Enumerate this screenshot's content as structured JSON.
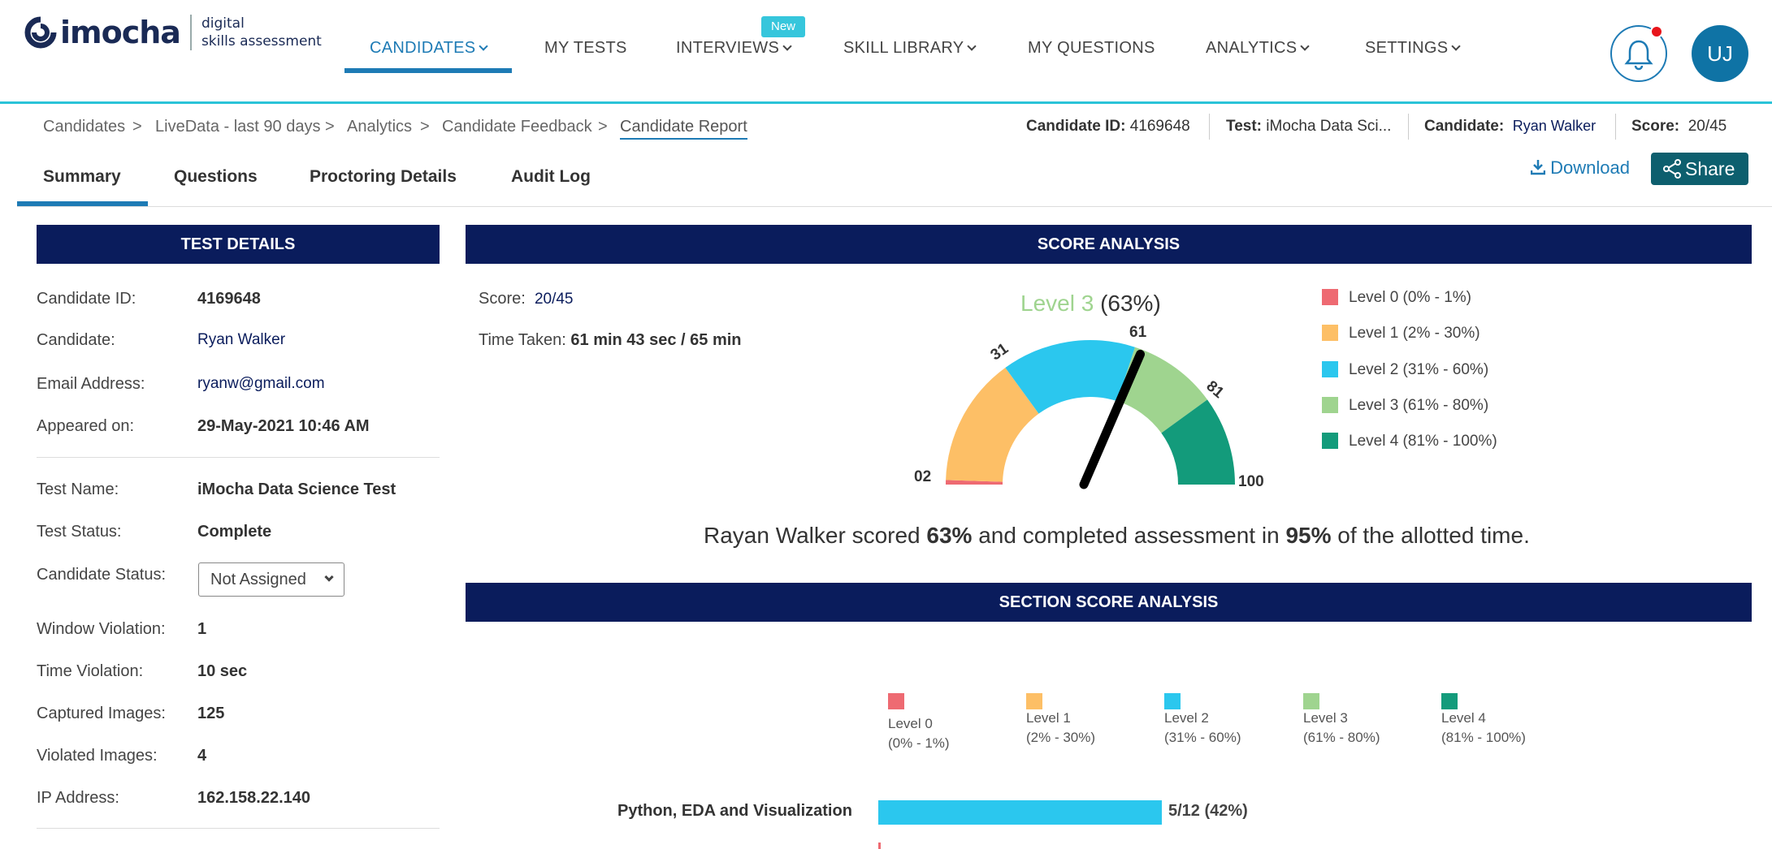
{
  "brand": {
    "name": "imocha",
    "subtitle_line1": "digital",
    "subtitle_line2": "skills assessment"
  },
  "nav": {
    "items": [
      {
        "label": "CANDIDATES",
        "active": true,
        "dropdown": true
      },
      {
        "label": "MY TESTS",
        "active": false,
        "dropdown": false
      },
      {
        "label": "INTERVIEWS",
        "active": false,
        "dropdown": true
      },
      {
        "label": "SKILL LIBRARY",
        "active": false,
        "dropdown": true
      },
      {
        "label": "MY QUESTIONS",
        "active": false,
        "dropdown": false
      },
      {
        "label": "ANALYTICS",
        "active": false,
        "dropdown": true
      },
      {
        "label": "SETTINGS",
        "active": false,
        "dropdown": true
      }
    ],
    "new_badge": "New",
    "user_initials": "UJ"
  },
  "breadcrumb": [
    "Candidates",
    "LiveData - last 90 days",
    "Analytics",
    "Candidate Feedback",
    "Candidate Report"
  ],
  "breadcrumb_sep": ">",
  "header_meta": {
    "candidate_id_label": "Candidate ID:",
    "candidate_id": "4169648",
    "test_label": "Test:",
    "test": "iMocha Data Sci...",
    "candidate_label": "Candidate:",
    "candidate": "Ryan Walker",
    "score_label": "Score:",
    "score": "20/45"
  },
  "tabs": [
    "Summary",
    "Questions",
    "Proctoring Details",
    "Audit Log"
  ],
  "actions": {
    "download": "Download",
    "share": "Share"
  },
  "test_details": {
    "title": "TEST DETAILS",
    "rows1": [
      {
        "label": "Candidate ID:",
        "value": "4169648"
      },
      {
        "label": "Candidate:",
        "value": "Ryan Walker"
      },
      {
        "label": "Email Address:",
        "value": "ryanw@gmail.com"
      },
      {
        "label": "Appeared on:",
        "value": "29-May-2021 10:46 AM"
      }
    ],
    "rows2": [
      {
        "label": "Test Name:",
        "value": "iMocha Data Science Test"
      },
      {
        "label": "Test Status:",
        "value": "Complete"
      },
      {
        "label": "Candidate Status:",
        "value": "Not Assigned"
      },
      {
        "label": "Window Violation:",
        "value": "1"
      },
      {
        "label": "Time Violation:",
        "value": "10 sec"
      },
      {
        "label": "Captured Images:",
        "value": "125"
      },
      {
        "label": "Violated Images:",
        "value": "4"
      },
      {
        "label": "IP Address:",
        "value": "162.158.22.140"
      }
    ]
  },
  "score_analysis": {
    "title": "SCORE ANALYSIS",
    "score_label": "Score:",
    "score": "20/45",
    "time_label": "Time Taken:",
    "time": "61 min 43 sec / 65 min",
    "level_text": "Level 3",
    "level_pct": "(63%)",
    "gauge_value": 63,
    "gauge_labels": [
      "02",
      "31",
      "61",
      "81",
      "100"
    ],
    "legend": [
      {
        "label": "Level 0 (0% - 1%)",
        "color": "#ee6a72"
      },
      {
        "label": "Level 1 (2% - 30%)",
        "color": "#fdbf66"
      },
      {
        "label": "Level 2 (31% - 60%)",
        "color": "#2bc7ee"
      },
      {
        "label": "Level 3 (61% - 80%)",
        "color": "#9fd48f"
      },
      {
        "label": "Level 4 (81% - 100%)",
        "color": "#139b7b"
      }
    ],
    "summary_pre": "Rayan Walker scored ",
    "summary_pct": "63%",
    "summary_mid": " and completed assessment in ",
    "summary_time": "95%",
    "summary_post": " of the allotted time."
  },
  "section_score": {
    "title": "SECTION SCORE ANALYSIS",
    "legend": [
      {
        "name": "Level 0",
        "range": "(0% - 1%)",
        "color": "#ee6a72"
      },
      {
        "name": "Level 1",
        "range": "(2% - 30%)",
        "color": "#fdbf66"
      },
      {
        "name": "Level 2",
        "range": "(31% - 60%)",
        "color": "#2bc7ee"
      },
      {
        "name": "Level 3",
        "range": "(61% - 80%)",
        "color": "#9fd48f"
      },
      {
        "name": "Level 4",
        "range": "(81% - 100%)",
        "color": "#139b7b"
      }
    ],
    "sections": [
      {
        "name": "Python, EDA and Visualization",
        "label": "5/12 (42%)",
        "percent": 42,
        "color": "#2bc7ee"
      }
    ]
  }
}
